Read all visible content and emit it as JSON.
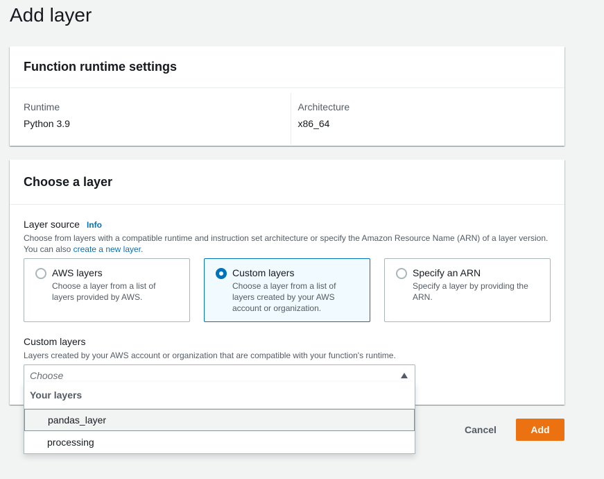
{
  "page": {
    "title": "Add layer"
  },
  "runtime_panel": {
    "title": "Function runtime settings",
    "runtime_label": "Runtime",
    "runtime_value": "Python 3.9",
    "architecture_label": "Architecture",
    "architecture_value": "x86_64"
  },
  "layer_panel": {
    "title": "Choose a layer",
    "source_label": "Layer source",
    "info_link": "Info",
    "source_desc_before": "Choose from layers with a compatible runtime and instruction set architecture or specify the Amazon Resource Name (ARN) of a layer version. You can also ",
    "source_desc_link": "create a new layer",
    "source_desc_after": ".",
    "options": [
      {
        "label": "AWS layers",
        "desc": "Choose a layer from a list of layers provided by AWS.",
        "selected": false
      },
      {
        "label": "Custom layers",
        "desc": "Choose a layer from a list of layers created by your AWS account or organization.",
        "selected": true
      },
      {
        "label": "Specify an ARN",
        "desc": "Specify a layer by providing the ARN.",
        "selected": false
      }
    ],
    "custom_label": "Custom layers",
    "custom_desc": "Layers created by your AWS account or organization that are compatible with your function's runtime.",
    "select_placeholder": "Choose"
  },
  "dropdown": {
    "group_label": "Your layers",
    "options": [
      "pandas_layer",
      "processing"
    ],
    "highlighted_index": 0
  },
  "footer": {
    "cancel_label": "Cancel",
    "add_label": "Add"
  },
  "colors": {
    "accent": "#0073bb",
    "primary_button": "#ec7211",
    "background": "#f2f3f3"
  }
}
